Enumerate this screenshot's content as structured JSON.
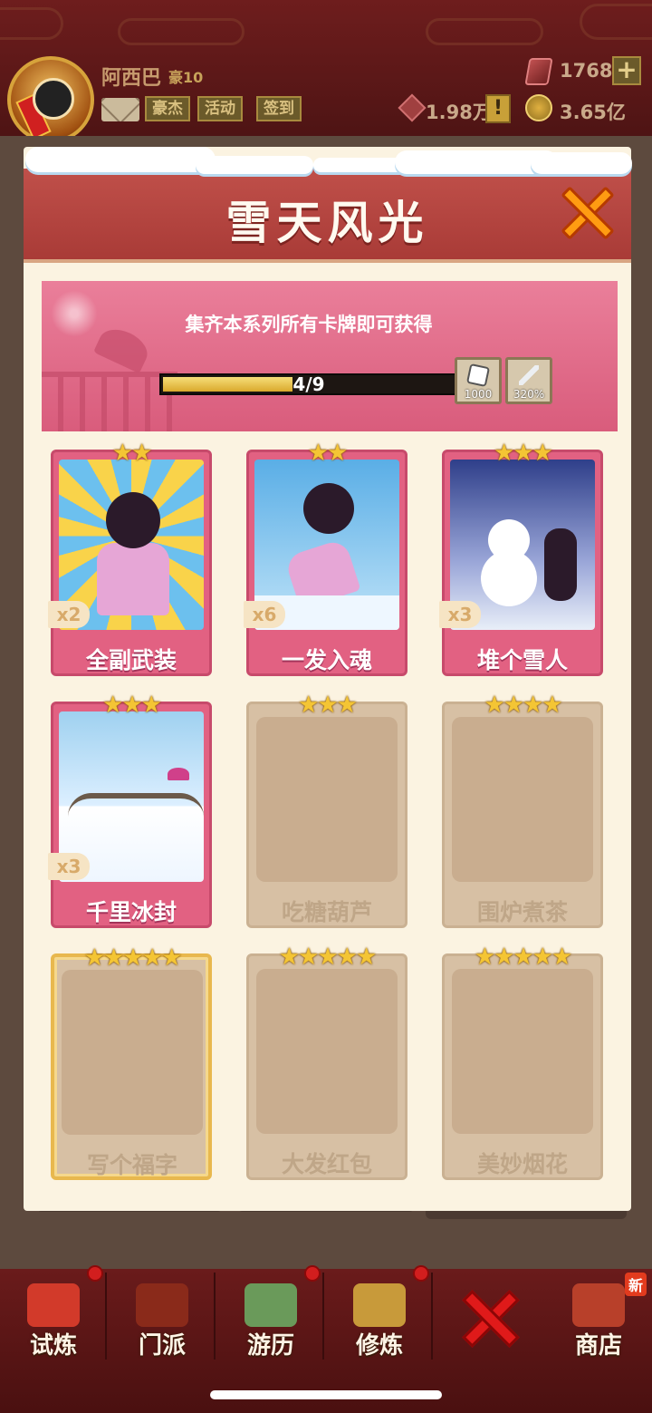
{
  "hud": {
    "player_name": "阿西巴",
    "player_rank": "豪10",
    "buttons": [
      "豪杰",
      "活动",
      "签到"
    ],
    "gems": "1768",
    "power": "1.98万",
    "coins": "3.65亿"
  },
  "panel": {
    "title": "雪天风光",
    "banner_text": "集齐本系列所有卡牌即可获得",
    "progress": {
      "collected": 4,
      "total": 9,
      "label": "4/9"
    },
    "rewards": [
      {
        "icon": "dice-icon",
        "amount": "1000"
      },
      {
        "icon": "sword-icon",
        "amount": "320%"
      }
    ],
    "cards": [
      {
        "name": "全副武装",
        "stars": "★★",
        "count": "x2",
        "collected": true,
        "scene": "burst"
      },
      {
        "name": "一发入魂",
        "stars": "★★",
        "count": "x6",
        "collected": true,
        "scene": "sky"
      },
      {
        "name": "堆个雪人",
        "stars": "★★★",
        "count": "x3",
        "collected": true,
        "scene": "night"
      },
      {
        "name": "千里冰封",
        "stars": "★★★",
        "count": "x3",
        "collected": true,
        "scene": "field"
      },
      {
        "name": "吃糖葫芦",
        "stars": "★★★",
        "count": "",
        "collected": false
      },
      {
        "name": "围炉煮茶",
        "stars": "★★★★",
        "count": "",
        "collected": false
      },
      {
        "name": "写个福字",
        "stars": "★★★★★",
        "count": "",
        "collected": false,
        "gold": true
      },
      {
        "name": "大发红包",
        "stars": "★★★★★",
        "count": "",
        "collected": false
      },
      {
        "name": "美妙烟花",
        "stars": "★★★★★",
        "count": "",
        "collected": false
      }
    ]
  },
  "bottom_nav": {
    "items": [
      {
        "label": "试炼",
        "icon": "trial-icon",
        "color": "#d23a2a"
      },
      {
        "label": "门派",
        "icon": "sect-icon",
        "color": "#8a2a1a"
      },
      {
        "label": "游历",
        "icon": "travel-icon",
        "color": "#6a9a5a"
      },
      {
        "label": "修炼",
        "icon": "train-icon",
        "color": "#c89a3a"
      },
      {
        "label": "商店",
        "icon": "shop-icon",
        "color": "#b8402a"
      }
    ],
    "new_badge": "新"
  }
}
